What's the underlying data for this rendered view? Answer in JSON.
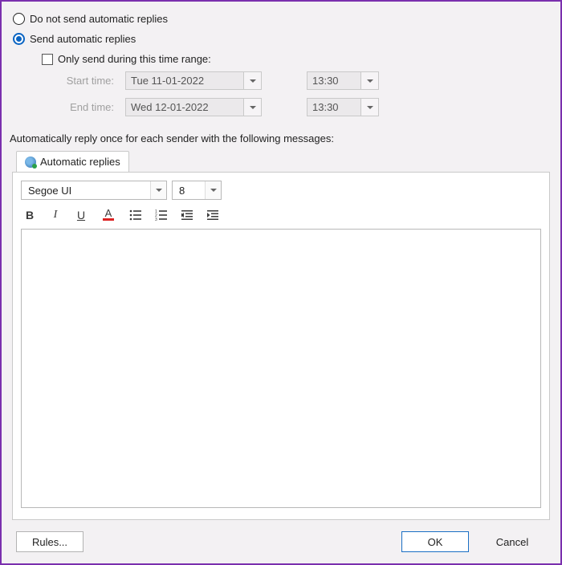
{
  "radios": {
    "no_send": "Do not send automatic replies",
    "send": "Send automatic replies"
  },
  "checkbox": {
    "range_label": "Only send during this time range:"
  },
  "labels": {
    "start": "Start time:",
    "end": "End time:"
  },
  "dates": {
    "start_date": "Tue 11-01-2022",
    "start_time": "13:30",
    "end_date": "Wed 12-01-2022",
    "end_time": "13:30"
  },
  "section_text": "Automatically reply once for each sender with the following messages:",
  "tab": {
    "label": "Automatic replies"
  },
  "font": {
    "name": "Segoe UI",
    "size": "8"
  },
  "buttons": {
    "rules": "Rules...",
    "ok": "OK",
    "cancel": "Cancel"
  }
}
